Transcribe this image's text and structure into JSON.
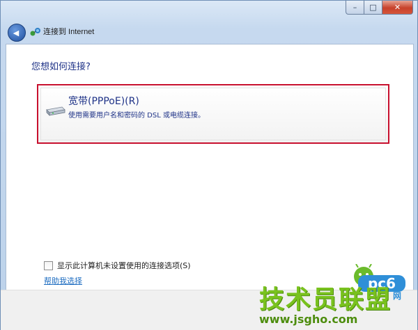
{
  "window": {
    "title": "连接到 Internet",
    "caption_min": "–",
    "caption_max": "□",
    "caption_close": "✕"
  },
  "nav": {
    "back_glyph": "◀"
  },
  "content": {
    "heading": "您想如何连接?",
    "option": {
      "title": "宽带(PPPoE)(R)",
      "description": "使用需要用户名和密码的 DSL 或电缆连接。",
      "icon": "broadband-modem-icon"
    },
    "checkbox_label": "显示此计算机未设置使用的连接选项(S)",
    "checkbox_checked": false,
    "help_link": "帮助我选择"
  },
  "watermark": {
    "text": "技术员联盟",
    "url": "www.jsgho.com",
    "logo_text": "pc6",
    "logo_sub": "网"
  },
  "colors": {
    "highlight_border": "#c8102e",
    "heading": "#1e3287",
    "link": "#1d6cc0",
    "watermark": "#79c21e"
  }
}
